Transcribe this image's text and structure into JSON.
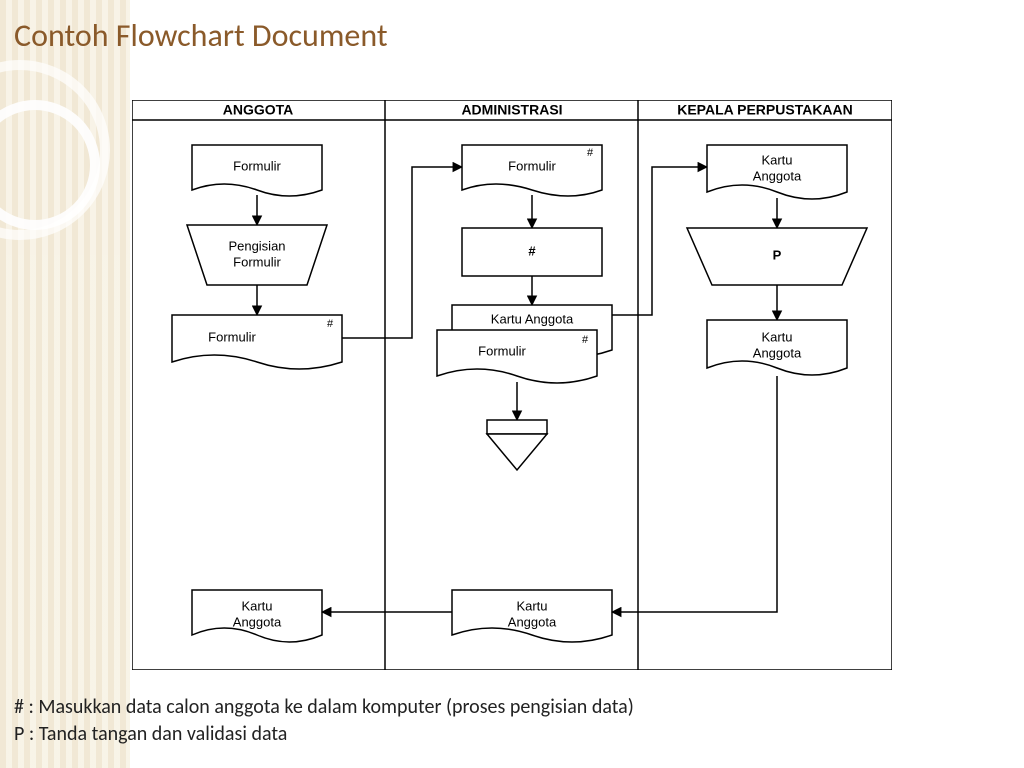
{
  "title": "Contoh Flowchart Document",
  "swimlanes": [
    {
      "id": "anggota",
      "header": "ANGGOTA"
    },
    {
      "id": "admin",
      "header": "ADMINISTRASI"
    },
    {
      "id": "kepala",
      "header": "KEPALA PERPUSTAKAAN"
    }
  ],
  "shapes": {
    "anggota": {
      "doc1": {
        "type": "document",
        "label": "Formulir"
      },
      "manual1": {
        "type": "manual",
        "line1": "Pengisian",
        "line2": "Formulir"
      },
      "doc2": {
        "type": "document",
        "label": "Formulir",
        "mark": "#"
      },
      "doc_end": {
        "type": "document",
        "line1": "Kartu",
        "line2": "Anggota"
      }
    },
    "admin": {
      "doc1": {
        "type": "document",
        "label": "Formulir",
        "mark": "#"
      },
      "proc": {
        "type": "process",
        "label": "#"
      },
      "doc2a": {
        "type": "document",
        "label": "Kartu Anggota"
      },
      "doc2b": {
        "type": "document",
        "label": "Formulir",
        "mark": "#"
      },
      "offpage": {
        "type": "offpage"
      },
      "doc_end": {
        "type": "document",
        "line1": "Kartu",
        "line2": "Anggota"
      }
    },
    "kepala": {
      "doc1": {
        "type": "document",
        "line1": "Kartu",
        "line2": "Anggota"
      },
      "manual1": {
        "type": "manual",
        "label": "P"
      },
      "doc2": {
        "type": "document",
        "line1": "Kartu",
        "line2": "Anggota"
      }
    }
  },
  "legend": {
    "hash": "# : Masukkan data calon anggota ke dalam komputer (proses pengisian data)",
    "p": "P : Tanda tangan dan validasi data"
  }
}
